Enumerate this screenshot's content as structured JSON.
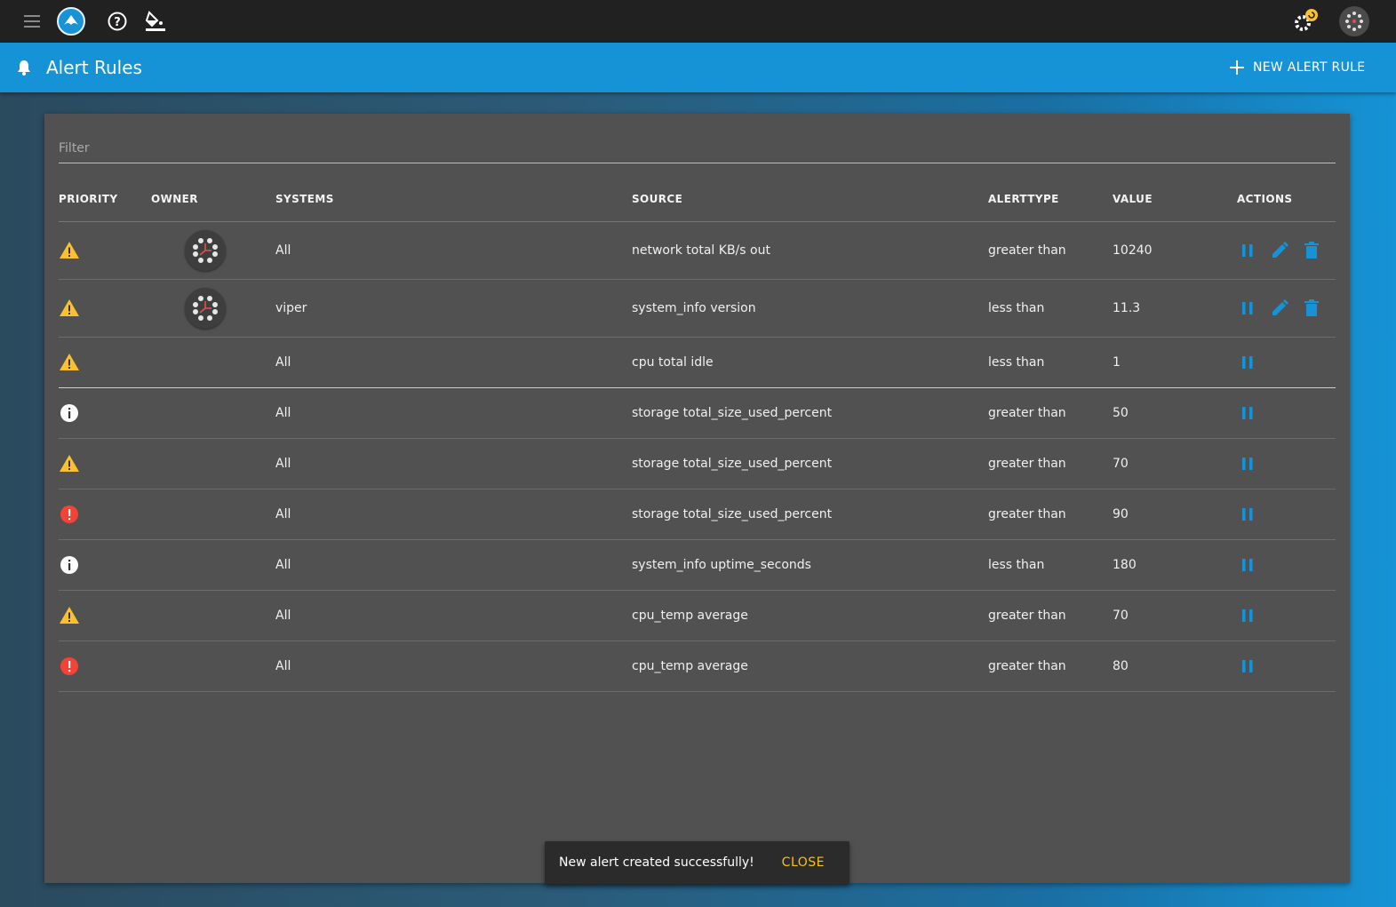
{
  "header": {
    "title": "Alert Rules",
    "new_button_label": "NEW ALERT RULE"
  },
  "icons": {
    "menu": "menu-icon",
    "logo": "app-logo-icon",
    "help": "help-circle-icon",
    "theme": "paint-bucket-icon",
    "settings": "gear-update-icon",
    "user": "user-avatar-icon"
  },
  "filter": {
    "placeholder": "Filter"
  },
  "table": {
    "columns": [
      "PRIORITY",
      "OWNER",
      "SYSTEMS",
      "SOURCE",
      "ALERTTYPE",
      "VALUE",
      "ACTIONS"
    ],
    "rows": [
      {
        "priority": "warning",
        "owner": true,
        "systems": "All",
        "source": "network total KB/s out",
        "alerttype": "greater than",
        "value": "10240",
        "editable": true
      },
      {
        "priority": "warning",
        "owner": true,
        "systems": "viper",
        "source": "system_info version",
        "alerttype": "less than",
        "value": "11.3",
        "editable": true
      },
      {
        "priority": "warning",
        "owner": false,
        "systems": "All",
        "source": "cpu total idle",
        "alerttype": "less than",
        "value": "1",
        "editable": false
      },
      {
        "priority": "info",
        "owner": false,
        "systems": "All",
        "source": "storage total_size_used_percent",
        "alerttype": "greater than",
        "value": "50",
        "editable": false
      },
      {
        "priority": "warning",
        "owner": false,
        "systems": "All",
        "source": "storage total_size_used_percent",
        "alerttype": "greater than",
        "value": "70",
        "editable": false
      },
      {
        "priority": "critical",
        "owner": false,
        "systems": "All",
        "source": "storage total_size_used_percent",
        "alerttype": "greater than",
        "value": "90",
        "editable": false
      },
      {
        "priority": "info",
        "owner": false,
        "systems": "All",
        "source": "system_info uptime_seconds",
        "alerttype": "less than",
        "value": "180",
        "editable": false
      },
      {
        "priority": "warning",
        "owner": false,
        "systems": "All",
        "source": "cpu_temp average",
        "alerttype": "greater than",
        "value": "70",
        "editable": false
      },
      {
        "priority": "critical",
        "owner": false,
        "systems": "All",
        "source": "cpu_temp average",
        "alerttype": "greater than",
        "value": "80",
        "editable": false
      }
    ]
  },
  "snackbar": {
    "message": "New alert created successfully!",
    "action": "CLOSE"
  },
  "colors": {
    "accent": "#1593d6",
    "warning": "#fbc02d",
    "critical": "#f44336",
    "info": "#ffffff",
    "snackbar_action": "#ffc107"
  }
}
